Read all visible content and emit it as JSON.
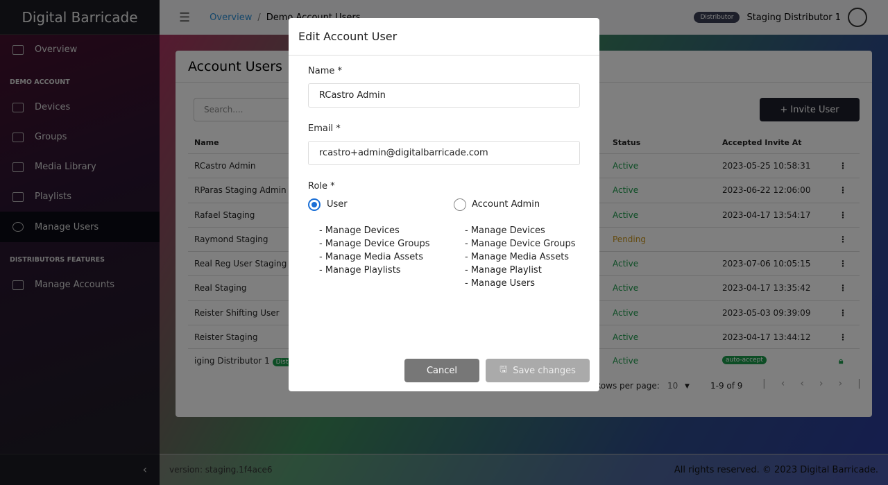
{
  "sidebar": {
    "brand": "Digital Barricade",
    "overview": "Overview",
    "section1": "DEMO ACCOUNT",
    "items": [
      "Devices",
      "Groups",
      "Media Library",
      "Playlists",
      "Manage Users"
    ],
    "section2": "DISTRIBUTORS FEATURES",
    "manage_accounts": "Manage Accounts",
    "collapse": "‹"
  },
  "header": {
    "menu": "☰",
    "crumb_home": "Overview",
    "crumb_sep": "/",
    "crumb_current": "Demo Account Users",
    "badge": "Distributor",
    "user": "Staging Distributor 1"
  },
  "card": {
    "title": "Account Users",
    "search_placeholder": "Search....",
    "invite": "+  Invite User",
    "headers": {
      "name": "Name",
      "status": "Status",
      "accepted": "Accepted Invite At"
    },
    "rows": [
      {
        "name": "RCastro Admin",
        "status": "Active",
        "accepted": "2023-05-25 10:58:31"
      },
      {
        "name": "RParas Staging Admin",
        "status": "Active",
        "accepted": "2023-06-22 12:06:00"
      },
      {
        "name": "Rafael Staging",
        "status": "Active",
        "accepted": "2023-04-17 13:54:17"
      },
      {
        "name": "Raymond Staging",
        "status": "Pending",
        "accepted": ""
      },
      {
        "name": "Real Reg User Staging",
        "status": "Active",
        "accepted": "2023-07-06 10:05:15"
      },
      {
        "name": "Real Staging",
        "status": "Active",
        "accepted": "2023-04-17 13:35:42"
      },
      {
        "name": "Reister Shifting User",
        "status": "Active",
        "accepted": "2023-05-03 09:39:09"
      },
      {
        "name": "Reister Staging",
        "status": "Active",
        "accepted": "2023-04-17 13:44:12"
      },
      {
        "name": "iging Distributor 1",
        "badge": "Distributor",
        "status": "Active",
        "accepted": "auto-accept"
      }
    ],
    "rows_per_page_label": "Rows per page:",
    "rows_per_page": "10",
    "range": "1-9 of 9"
  },
  "footer": {
    "version": "version: staging.1f4ace6",
    "rights": "All rights reserved. © 2023 Digital Barricade."
  },
  "modal": {
    "title": "Edit Account User",
    "name_label": "Name *",
    "name_value": "RCastro Admin",
    "email_label": "Email *",
    "email_value": "rcastro+admin@digitalbarricade.com",
    "role_label": "Role *",
    "roles": [
      {
        "label": "User",
        "selected": true,
        "perms": [
          "- Manage Devices",
          "- Manage Device Groups",
          "- Manage Media Assets",
          "- Manage Playlists"
        ]
      },
      {
        "label": "Account Admin",
        "selected": false,
        "perms": [
          "- Manage Devices",
          "- Manage Device Groups",
          "- Manage Media Assets",
          "- Manage Playlist",
          "- Manage Users"
        ]
      }
    ],
    "cancel": "Cancel",
    "save": "Save changes"
  },
  "colors": {
    "active": "#1a9a4a",
    "pending": "#c8941a",
    "primary": "#1a6fd6"
  }
}
